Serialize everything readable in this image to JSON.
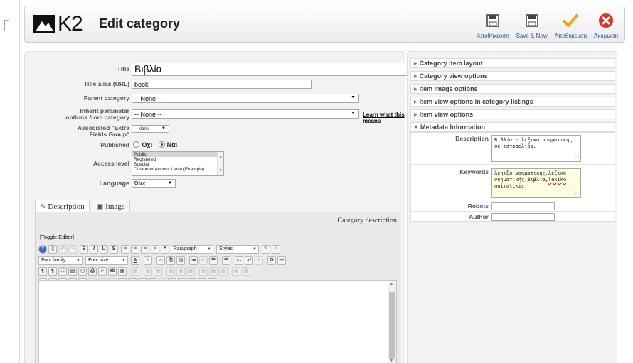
{
  "app": {
    "logo_text": "K2",
    "page_title": "Edit category"
  },
  "toolbar": [
    {
      "label": "Αποθήκευση",
      "icon": "save-icon"
    },
    {
      "label": "Save & New",
      "icon": "save-new-icon"
    },
    {
      "label": "Αποθήκευση",
      "icon": "apply-check-icon"
    },
    {
      "label": "Ακύρωση",
      "icon": "cancel-icon"
    }
  ],
  "form": {
    "title_label": "Title",
    "title_value": "Βιβλία",
    "alias_label": "Title alias (URL)",
    "alias_value": "book",
    "parent_label": "Parent category",
    "parent_value": "-- None --",
    "inherit_label_1": "Inherit parameter",
    "inherit_label_2": "options from category",
    "inherit_value": "-- None --",
    "learn_link": "Learn what this means",
    "extra_label_1": "Associated \"Extra",
    "extra_label_2": "Fields Group\"",
    "extra_value": "-- None --",
    "published_label": "Published",
    "published_no": "Όχι",
    "published_yes": "Ναι",
    "access_label": "Access level",
    "access_options": [
      "Public",
      "Registered",
      "Special",
      "Customer Access Level (Example)"
    ],
    "language_label": "Language",
    "language_value": "Όλες"
  },
  "tabs": {
    "description": "Description",
    "image": "Image"
  },
  "editor": {
    "caption": "Category description",
    "toggle": "[Toggle Editor]",
    "paragraph": "Paragraph",
    "styles": "Styles",
    "font_family": "Font family",
    "font_size": "Font size"
  },
  "accordion": [
    "Category item layout",
    "Category view options",
    "Item image options",
    "Item view options in category listings",
    "Item view options",
    "Metadata Information"
  ],
  "metadata": {
    "description_label": "Description",
    "description_value": "Βιβλία - λεξικο νοηματικής σε ιστοσελίδα.",
    "keywords_label": "Keywords",
    "keywords_value_1": "λεηιξο νοηματικης,λεξικό νοηματικής,βιβλία,",
    "keywords_value_2": "lexiko",
    "keywords_value_3": "noimatikis",
    "robots_label": "Robots",
    "author_label": "Author"
  },
  "colors": {
    "link_blue": "#1a55a8",
    "check_orange": "#f0a020",
    "cancel_red": "#d9342b",
    "accordion_triangle": "#2f7dd1"
  }
}
